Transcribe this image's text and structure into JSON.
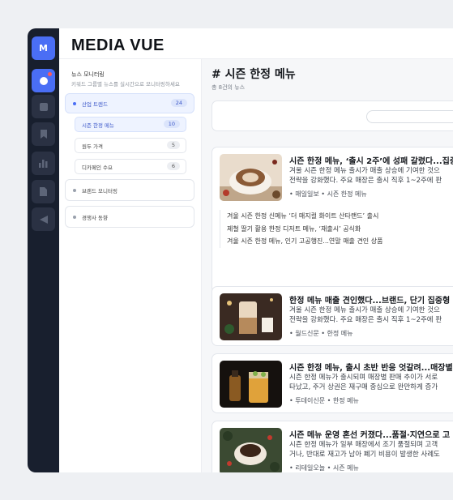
{
  "app": {
    "logo_letter": "M",
    "title": "MEDIA VUE"
  },
  "rail": {
    "icons": [
      "monitor-icon",
      "grid-icon",
      "bookmark-icon",
      "chart-icon",
      "document-icon",
      "send-icon"
    ]
  },
  "sidebar": {
    "title": "뉴스 모니터링",
    "description": "키워드 그룹별 뉴스를 실시간으로 모니터링하세요",
    "groups": [
      {
        "label": "산업 트렌드",
        "count": "24"
      },
      {
        "label": "브랜드 모니터링"
      },
      {
        "label": "경쟁사 동향"
      }
    ],
    "subitems": [
      {
        "label": "시즌 한정 메뉴",
        "count": "10"
      },
      {
        "label": "원두 가격",
        "count": "5"
      },
      {
        "label": "디카페인 수요",
        "count": "6"
      }
    ]
  },
  "main": {
    "title": "# 시즌 한정 메뉴",
    "count": "총 8건의 뉴스",
    "cards": [
      {
        "title": "시즌 한정 메뉴, ‘출시 2주’에 성패 갈렸다...집중",
        "body": [
          "겨울 시즌 한정 메뉴 출시가 매출 상승에 기여한 것으",
          "전략을 강화했다. 주요 매장은 출시 직후 1~2주에 판"
        ],
        "source": "매일일보",
        "tag": "시즌 한정 메뉴",
        "related": [
          "겨울 시즌 한정 신메뉴 ‘더 매지컬 화이트 산타랜드’ 출시",
          "제철 딸기 활용 한정 디저트 메뉴, ‘재출시’ 공식화",
          "겨울 시즌 한정 메뉴, 인기 고공행진...연말 매출 견인 상품"
        ]
      },
      {
        "title": "한정 메뉴 매출 견인했다...브랜드, 단기 집중형",
        "body": [
          "겨울 시즌 한정 메뉴 출시가 매출 상승에 기여한 것으",
          "전략을 강화했다. 주요 매장은 출시 직후 1~2주에 판"
        ],
        "source": "월드신문",
        "tag": "한정 메뉴"
      },
      {
        "title": "시즌 한정 메뉴, 출시 초반 반응 엇갈려...매장별",
        "body": [
          "시즌 한정 메뉴가 출시되며 매장별 판매 추이가 서로",
          "타났고, 주거 상권은 재구매 중심으로 완만하게 증가"
        ],
        "source": "투데이신문",
        "tag": "한정 메뉴"
      },
      {
        "title": "시즌 메뉴 운영 혼선 커졌다...품절·지연으로 고",
        "body": [
          "시즌 한정 메뉴가 일부 매장에서 조기 품절되며 고객",
          "거나, 반대로 재고가 남아 폐기 비용이 발생한 사례도"
        ],
        "source": "리테일오늘",
        "tag": "시즌 메뉴"
      }
    ]
  },
  "colors": {
    "accent": "#4a6ef5",
    "rail": "#181f2e"
  }
}
